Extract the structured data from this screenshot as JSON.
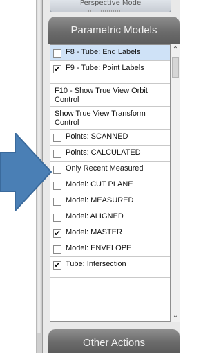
{
  "panel": {
    "prev_section_label": "Perspective Mode",
    "section_title": "Parametric Models",
    "next_section_title": "Other Actions"
  },
  "items": [
    {
      "label": "F8 - Tube: End Labels",
      "checked": false,
      "has_checkbox": true,
      "selected": true
    },
    {
      "label": "F9 - Tube: Point Labels",
      "checked": true,
      "has_checkbox": true,
      "selected": false
    },
    {
      "label": "F10 - Show True View Orbit Control",
      "checked": false,
      "has_checkbox": false,
      "selected": false
    },
    {
      "label": "Show True View Transform Control",
      "checked": false,
      "has_checkbox": false,
      "selected": false
    },
    {
      "label": "Points: SCANNED",
      "checked": false,
      "has_checkbox": true,
      "selected": false
    },
    {
      "label": "Points: CALCULATED",
      "checked": false,
      "has_checkbox": true,
      "selected": false
    },
    {
      "label": "Only Recent Measured",
      "checked": false,
      "has_checkbox": true,
      "selected": false
    },
    {
      "label": "Model: CUT PLANE",
      "checked": false,
      "has_checkbox": true,
      "selected": false
    },
    {
      "label": "Model: MEASURED",
      "checked": false,
      "has_checkbox": true,
      "selected": false
    },
    {
      "label": "Model: ALIGNED",
      "checked": false,
      "has_checkbox": true,
      "selected": false
    },
    {
      "label": "Model: MASTER",
      "checked": true,
      "has_checkbox": true,
      "selected": false
    },
    {
      "label": "Model: ENVELOPE",
      "checked": false,
      "has_checkbox": true,
      "selected": false
    },
    {
      "label": "Tube: Intersection",
      "checked": true,
      "has_checkbox": true,
      "selected": false
    }
  ],
  "scrollbar": {
    "up_icon": "chevron-up-icon",
    "down_icon": "chevron-down-icon"
  },
  "annotation": {
    "arrow_color": "#4a7fb5",
    "arrow_stroke": "#3a6a9c"
  }
}
